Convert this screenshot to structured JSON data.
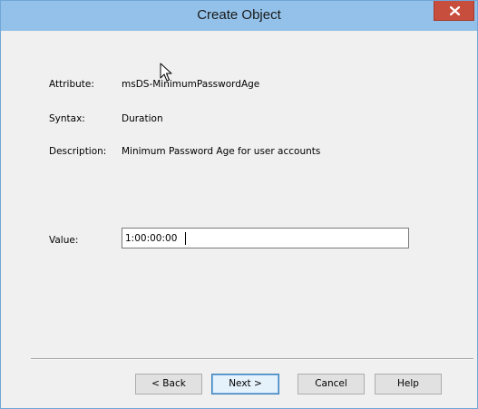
{
  "window": {
    "title": "Create Object",
    "close_label": "x"
  },
  "fields": {
    "attribute_label": "Attribute:",
    "attribute_value": "msDS-MinimumPasswordAge",
    "syntax_label": "Syntax:",
    "syntax_value": "Duration",
    "description_label": "Description:",
    "description_value": "Minimum Password Age for user accounts",
    "value_label": "Value:",
    "value_input": "1:00:00:00"
  },
  "buttons": {
    "back": "< Back",
    "next": "Next >",
    "cancel": "Cancel",
    "help": "Help"
  },
  "icons": {
    "close": "close-icon",
    "cursor": "mouse-pointer-icon"
  }
}
